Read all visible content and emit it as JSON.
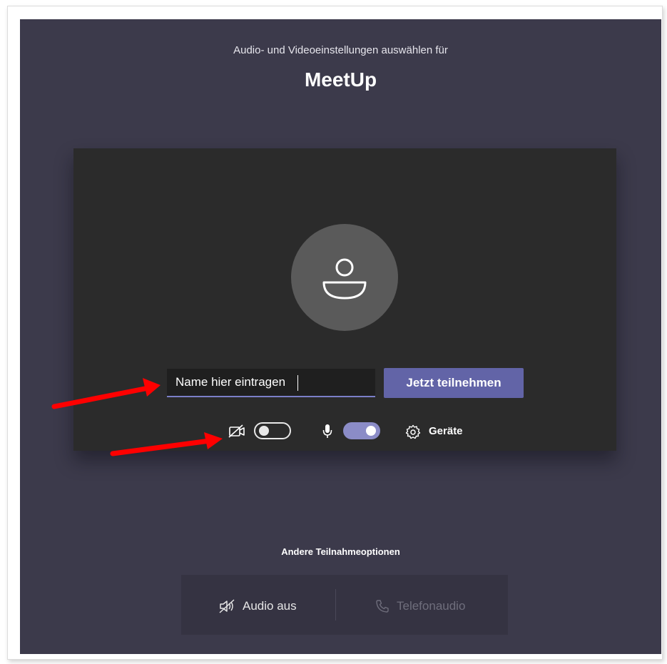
{
  "header": {
    "subtitle": "Audio- und Videoeinstellungen auswählen für",
    "meeting_title": "MeetUp"
  },
  "join": {
    "name_placeholder": "Name hier eintragen",
    "join_button_label": "Jetzt teilnehmen"
  },
  "controls": {
    "camera_toggle_on": false,
    "microphone_toggle_on": true,
    "devices_label": "Geräte"
  },
  "other_options": {
    "heading": "Andere Teilnahmeoptionen",
    "audio_off_label": "Audio aus",
    "phone_audio_label": "Telefonaudio"
  },
  "colors": {
    "background": "#3c3a4b",
    "preview": "#2b2b2b",
    "accent": "#6264a7",
    "annotation_arrow": "#ff0000"
  },
  "icons": [
    "person-icon",
    "camera-off-icon",
    "microphone-icon",
    "gear-icon",
    "speaker-off-icon",
    "phone-icon",
    "red-arrow"
  ]
}
